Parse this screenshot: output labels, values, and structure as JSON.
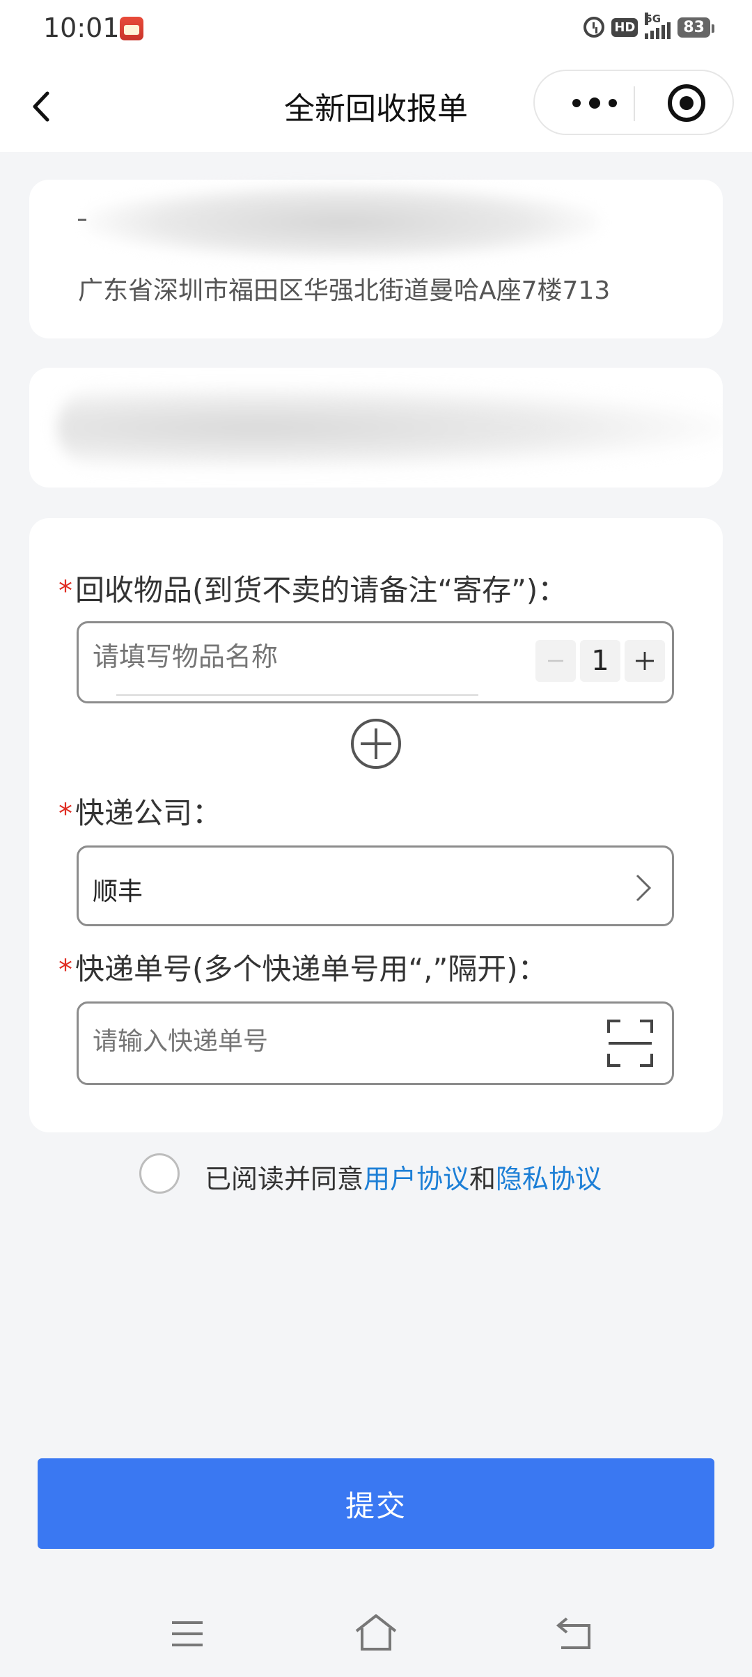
{
  "status_bar": {
    "time": "10:01",
    "hd_label": "HD",
    "network_label": "5G",
    "battery": "83"
  },
  "nav": {
    "title": "全新回收报单"
  },
  "address_card": {
    "name_prefix": "-",
    "address": "广东省深圳市福田区华强北街道曼哈A座7楼713"
  },
  "form": {
    "item_label": "回收物品(到货不卖的请备注“寄存”)：",
    "item_placeholder": "请填写物品名称",
    "quantity": "1",
    "minus_symbol": "−",
    "plus_symbol": "+",
    "express_label": "快递公司：",
    "express_value": "顺丰",
    "tracking_label": "快递单号(多个快递单号用“,”隔开)：",
    "tracking_placeholder": "请输入快递单号",
    "required_mark": "*"
  },
  "agreement": {
    "prefix": "已阅读并同意",
    "user_agreement": "用户协议",
    "conjunction": "和",
    "privacy_agreement": "隐私协议"
  },
  "submit_label": "提交",
  "colors": {
    "primary": "#3a78f2",
    "link": "#1d7fd6",
    "required": "#e02e24",
    "background": "#f4f5f7"
  }
}
